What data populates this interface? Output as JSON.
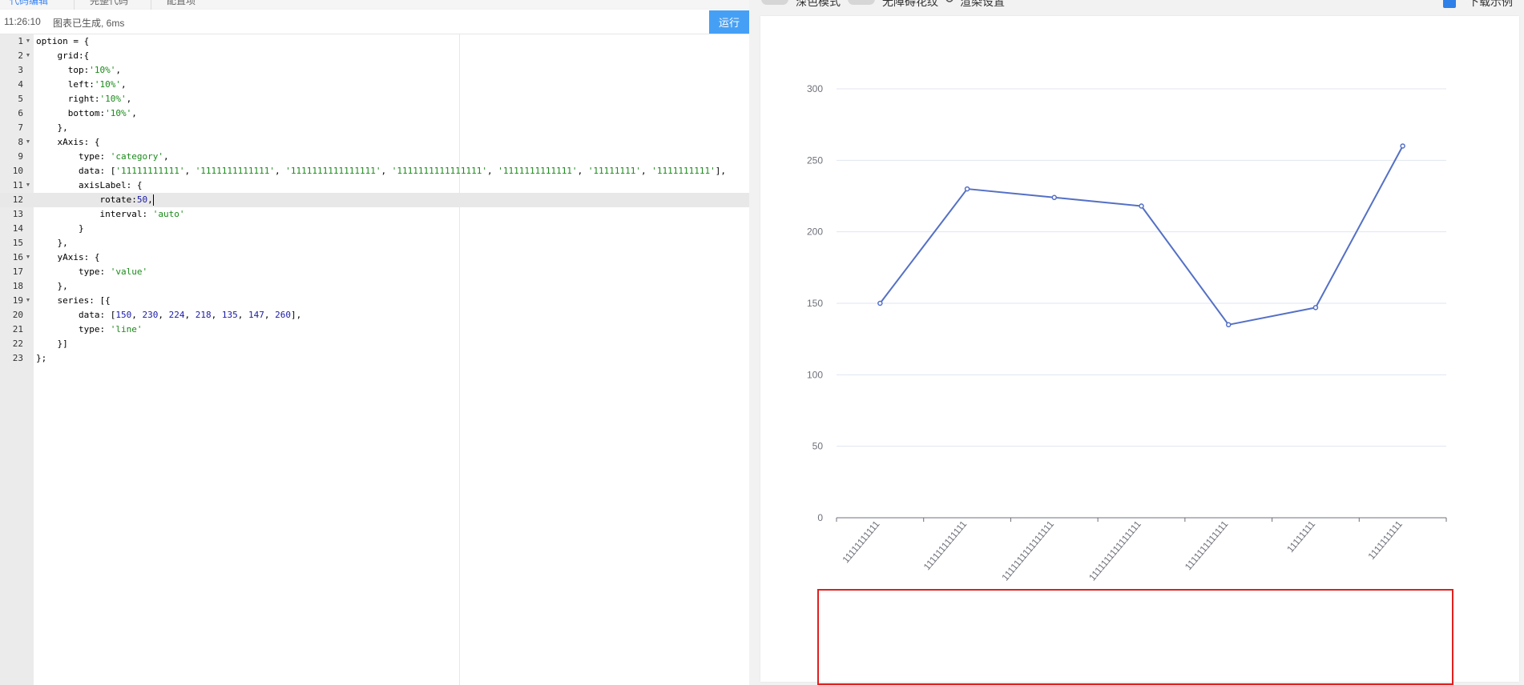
{
  "editor": {
    "tabs": [
      {
        "label": "代码编辑",
        "active": true
      },
      {
        "label": "完整代码",
        "active": false
      },
      {
        "label": "配置项",
        "active": false
      }
    ],
    "status": {
      "time": "11:26:10",
      "message": "图表已生成, 6ms"
    },
    "run_label": "运行",
    "active_line": 12,
    "lines": [
      {
        "n": "1",
        "fold": true,
        "html": "option = {"
      },
      {
        "n": "2",
        "fold": true,
        "html": "    grid:{"
      },
      {
        "n": "3",
        "fold": false,
        "html": "      top:<span class=\"s\">'10%'</span>,"
      },
      {
        "n": "4",
        "fold": false,
        "html": "      left:<span class=\"s\">'10%'</span>,"
      },
      {
        "n": "5",
        "fold": false,
        "html": "      right:<span class=\"s\">'10%'</span>,"
      },
      {
        "n": "6",
        "fold": false,
        "html": "      bottom:<span class=\"s\">'10%'</span>,"
      },
      {
        "n": "7",
        "fold": false,
        "html": "    },"
      },
      {
        "n": "8",
        "fold": true,
        "html": "    xAxis: {"
      },
      {
        "n": "9",
        "fold": false,
        "html": "        type: <span class=\"s\">'category'</span>,"
      },
      {
        "n": "10",
        "fold": false,
        "html": "        data: [<span class=\"s\">'11111111111'</span>, <span class=\"s\">'1111111111111'</span>, <span class=\"s\">'1111111111111111'</span>, <span class=\"s\">'1111111111111111'</span>, <span class=\"s\">'1111111111111'</span>, <span class=\"s\">'11111111'</span>, <span class=\"s\">'1111111111'</span>],"
      },
      {
        "n": "11",
        "fold": true,
        "html": "        axisLabel: {"
      },
      {
        "n": "12",
        "fold": false,
        "html": "            rotate:<span class=\"n\">50</span>,<span class=\"caret\"></span>"
      },
      {
        "n": "13",
        "fold": false,
        "html": "            interval: <span class=\"s\">'auto'</span>"
      },
      {
        "n": "14",
        "fold": false,
        "html": "        }"
      },
      {
        "n": "15",
        "fold": false,
        "html": "    },"
      },
      {
        "n": "16",
        "fold": true,
        "html": "    yAxis: {"
      },
      {
        "n": "17",
        "fold": false,
        "html": "        type: <span class=\"s\">'value'</span>"
      },
      {
        "n": "18",
        "fold": false,
        "html": "    },"
      },
      {
        "n": "19",
        "fold": true,
        "html": "    series: [{"
      },
      {
        "n": "20",
        "fold": false,
        "html": "        data: [<span class=\"n\">150</span>, <span class=\"n\">230</span>, <span class=\"n\">224</span>, <span class=\"n\">218</span>, <span class=\"n\">135</span>, <span class=\"n\">147</span>, <span class=\"n\">260</span>],"
      },
      {
        "n": "21",
        "fold": false,
        "html": "        type: <span class=\"s\">'line'</span>"
      },
      {
        "n": "22",
        "fold": false,
        "html": "    }]"
      },
      {
        "n": "23",
        "fold": false,
        "html": "};"
      }
    ]
  },
  "preview": {
    "toolbar": {
      "toggle1_label": "深色模式",
      "toggle2_label": "无障碍花纹",
      "settings_label": "渲染设置",
      "download_label": "下载示例"
    },
    "highlight_color": "#e0201e"
  },
  "colors": {
    "accent": "#45a0f5",
    "series": "#5470c6"
  },
  "chart_data": {
    "type": "line",
    "categories": [
      "11111111111",
      "1111111111111",
      "1111111111111111",
      "1111111111111111",
      "1111111111111",
      "11111111",
      "1111111111"
    ],
    "series": [
      {
        "values": [
          150,
          230,
          224,
          218,
          135,
          147,
          260
        ]
      }
    ],
    "yticks": [
      0,
      50,
      100,
      150,
      200,
      250,
      300
    ],
    "ylim": [
      0,
      300
    ],
    "grid": true,
    "x_label_rotate": 50
  }
}
